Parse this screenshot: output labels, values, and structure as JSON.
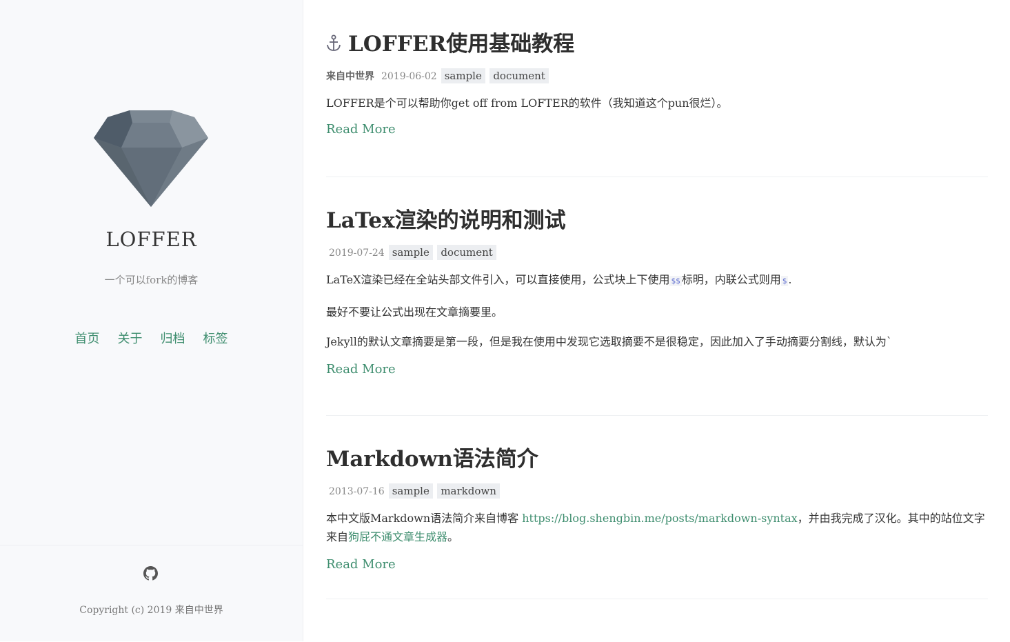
{
  "sidebar": {
    "logo_icon": "diamond-gem-logo",
    "title": "LOFFER",
    "description": "一个可以fork的博客",
    "nav": [
      {
        "label": "首页"
      },
      {
        "label": "关于"
      },
      {
        "label": "归档"
      },
      {
        "label": "标签"
      }
    ],
    "github_icon": "github-icon",
    "copyright": "Copyright (c) 2019 来自中世界"
  },
  "colors": {
    "accent": "#3f8e6f",
    "sidebar_bg": "#f8f9fb",
    "tag_bg": "#eceef1",
    "text": "#333333"
  },
  "posts": [
    {
      "title": "LOFFER使用基础教程",
      "anchor_icon": "anchor-icon",
      "author": "来自中世界",
      "date": "2019-06-02",
      "tags": [
        "sample",
        "document"
      ],
      "excerpt": [
        "LOFFER是个可以帮助你get off from LOFTER的软件（我知道这个pun很烂）。"
      ],
      "read_more": "Read More"
    },
    {
      "title": "LaTex渲染的说明和测试",
      "date": "2019-07-24",
      "tags": [
        "sample",
        "document"
      ],
      "excerpt_line1": {
        "before": "LaTeX渲染已经在全站头部文件引入，可以直接使用，公式块上下使用",
        "code1": "$$",
        "middle": "标明，内联公式则用",
        "code2": "$",
        "after": "."
      },
      "excerpt_line2": "最好不要让公式出现在文章摘要里。",
      "excerpt_line3": "Jekyll的默认文章摘要是第一段，但是我在使用中发现它选取摘要不是很稳定，因此加入了手动摘要分割线，默认为`",
      "read_more": "Read More"
    },
    {
      "title": "Markdown语法简介",
      "date": "2013-07-16",
      "tags": [
        "sample",
        "markdown"
      ],
      "excerpt": {
        "before": "本中文版Markdown语法简介来自博客 ",
        "link1": "https://blog.shengbin.me/posts/markdown-syntax",
        "middle": "，并由我完成了汉化。其中的站位文字来自",
        "link2": "狗屁不通文章生成器",
        "after": "。"
      },
      "read_more": "Read More"
    }
  ]
}
